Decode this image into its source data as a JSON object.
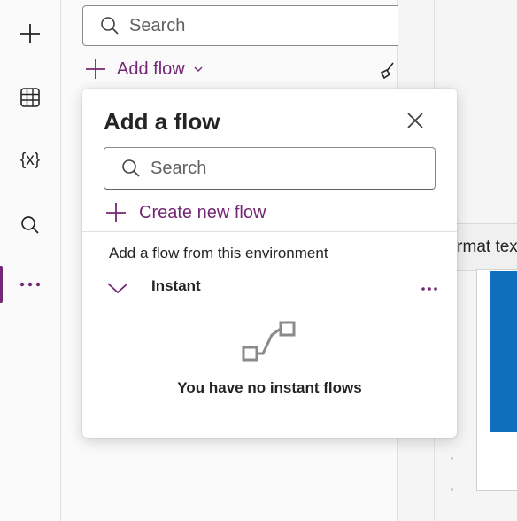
{
  "rail": {
    "items": [
      {
        "icon": "plus-icon"
      },
      {
        "icon": "table-icon"
      },
      {
        "icon": "variables-icon",
        "glyph": "{x}"
      },
      {
        "icon": "search-icon"
      },
      {
        "icon": "more-icon",
        "active": true
      }
    ]
  },
  "panel": {
    "search_placeholder": "Search",
    "add_flow_label": "Add flow"
  },
  "popup": {
    "title": "Add a flow",
    "search_placeholder": "Search",
    "create_label": "Create new flow",
    "section_label": "Add a flow from this environment",
    "group_label": "Instant",
    "empty_text": "You have no instant flows"
  },
  "tooltip": {
    "text": "Format text"
  },
  "colors": {
    "accent": "#742774",
    "canvas_blue": "#106ebe"
  }
}
